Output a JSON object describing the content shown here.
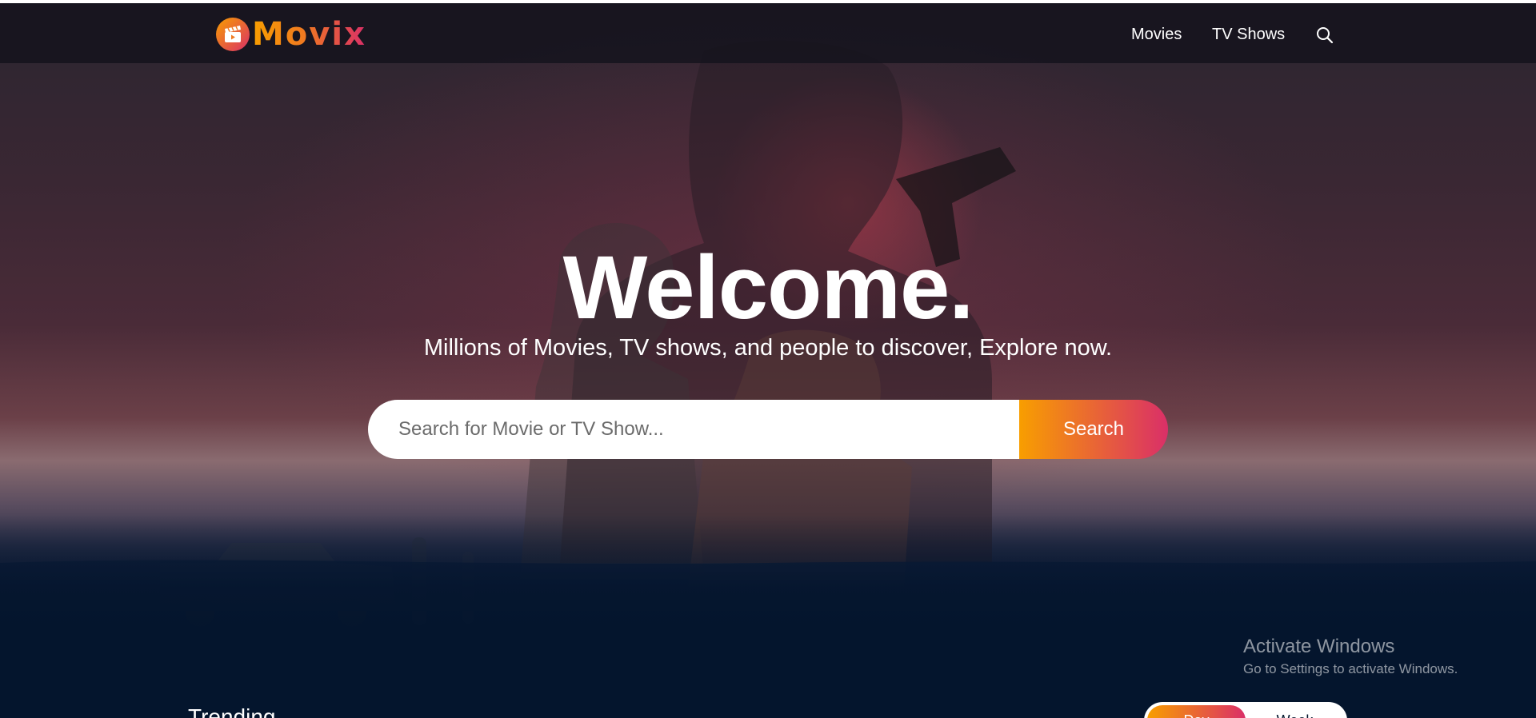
{
  "app": {
    "name": "Movix"
  },
  "header": {
    "nav": [
      {
        "label": "Movies"
      },
      {
        "label": "TV Shows"
      }
    ],
    "search_icon": "search-icon"
  },
  "hero": {
    "title": "Welcome.",
    "subtitle": "Millions of Movies, TV shows, and people to discover, Explore now.",
    "search": {
      "placeholder": "Search for Movie or TV Show...",
      "value": "",
      "button_label": "Search"
    }
  },
  "trending": {
    "title": "Trending",
    "tabs": [
      {
        "label": "Day",
        "active": true
      },
      {
        "label": "Week",
        "active": false
      }
    ]
  },
  "watermark": {
    "title": "Activate Windows",
    "subtitle": "Go to Settings to activate Windows."
  },
  "colors": {
    "accent_start": "#f89e00",
    "accent_end": "#da2f68",
    "background": "#04152d"
  }
}
